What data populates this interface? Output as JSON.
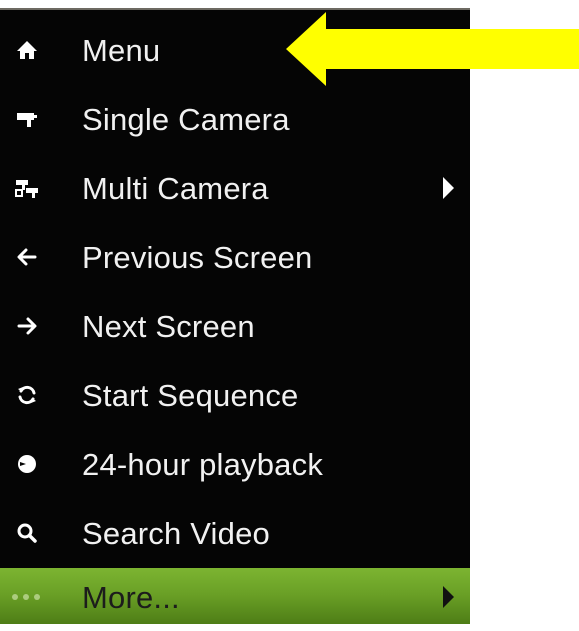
{
  "menu": {
    "items": [
      {
        "label": "Menu",
        "icon": "home-icon",
        "has_submenu": false
      },
      {
        "label": "Single Camera",
        "icon": "camera-icon",
        "has_submenu": false
      },
      {
        "label": "Multi Camera",
        "icon": "multi-camera-icon",
        "has_submenu": true
      },
      {
        "label": "Previous Screen",
        "icon": "arrow-left-icon",
        "has_submenu": false
      },
      {
        "label": "Next Screen",
        "icon": "arrow-right-icon",
        "has_submenu": false
      },
      {
        "label": "Start Sequence",
        "icon": "refresh-icon",
        "has_submenu": false
      },
      {
        "label": "24-hour playback",
        "icon": "playback-icon",
        "has_submenu": false
      },
      {
        "label": "Search Video",
        "icon": "search-icon",
        "has_submenu": false
      },
      {
        "label": "More...",
        "icon": "more-dots-icon",
        "has_submenu": true,
        "highlighted": true
      }
    ]
  },
  "colors": {
    "menu_background": "#050505",
    "menu_text": "#f1f1f1",
    "highlight_green": "#6aa026",
    "callout_yellow": "#ffff00"
  }
}
